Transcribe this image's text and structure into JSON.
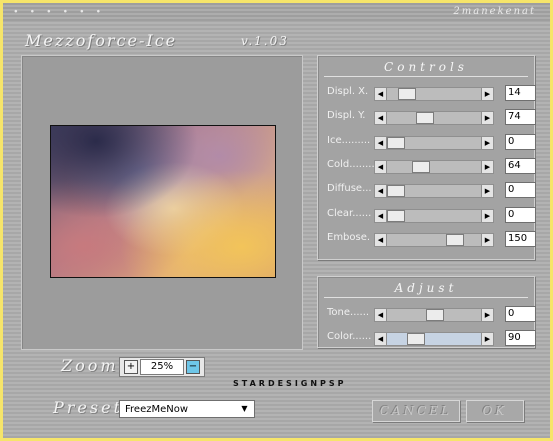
{
  "window": {
    "dots": "∙ ∙ ∙ ∙ ∙ ∙",
    "brand": "2manekenat",
    "title": "Mezzoforce-Ice",
    "version": "v.1.03"
  },
  "controls": {
    "title": "Controls",
    "sliders": [
      {
        "label": "Displ. X.",
        "value": "14",
        "fraction": 0.14
      },
      {
        "label": "Displ. Y.",
        "value": "74",
        "fraction": 0.37
      },
      {
        "label": "Ice.........",
        "value": "0",
        "fraction": 0.0
      },
      {
        "label": "Cold........",
        "value": "64",
        "fraction": 0.32
      },
      {
        "label": "Diffuse...",
        "value": "0",
        "fraction": 0.0
      },
      {
        "label": "Clear......",
        "value": "0",
        "fraction": 0.0
      },
      {
        "label": "Embose.",
        "value": "150",
        "fraction": 0.75
      }
    ]
  },
  "adjust": {
    "title": "Adjust",
    "sliders": [
      {
        "label": "Tone......",
        "value": "0",
        "fraction": 0.5
      },
      {
        "label": "Color......",
        "value": "90",
        "fraction": 0.25
      }
    ]
  },
  "zoom": {
    "label": "Zoom",
    "value": "25%",
    "plus": "+",
    "minus": "−"
  },
  "credit": "STARDESIGNPSP",
  "preset": {
    "label": "Preset",
    "selected": "FreezMeNow"
  },
  "buttons": {
    "cancel": "CANCEL",
    "ok": "OK"
  },
  "colors": {
    "frame": "#f6e56a",
    "selected_track": "#c6d3e3"
  }
}
